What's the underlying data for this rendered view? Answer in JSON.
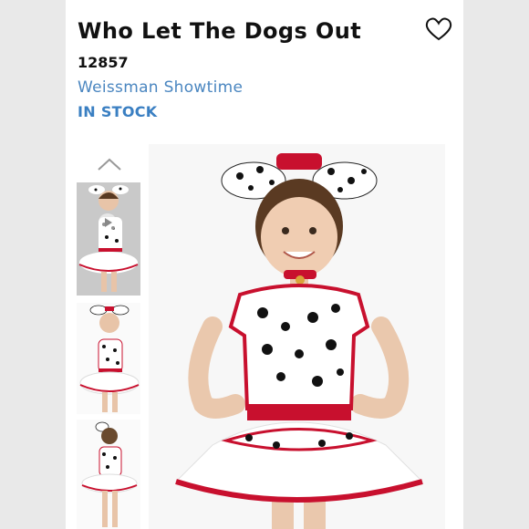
{
  "product": {
    "title": "Who Let The Dogs Out",
    "sku": "12857",
    "brand": "Weissman Showtime",
    "stock_status": "IN STOCK"
  },
  "icons": {
    "favorite": "heart-outline-icon",
    "gallery_up": "chevron-up-icon",
    "video_play": "play-icon"
  },
  "colors": {
    "brand_link": "#4a86c0",
    "stock": "#3a7fc2",
    "costume_red": "#c8102e"
  }
}
